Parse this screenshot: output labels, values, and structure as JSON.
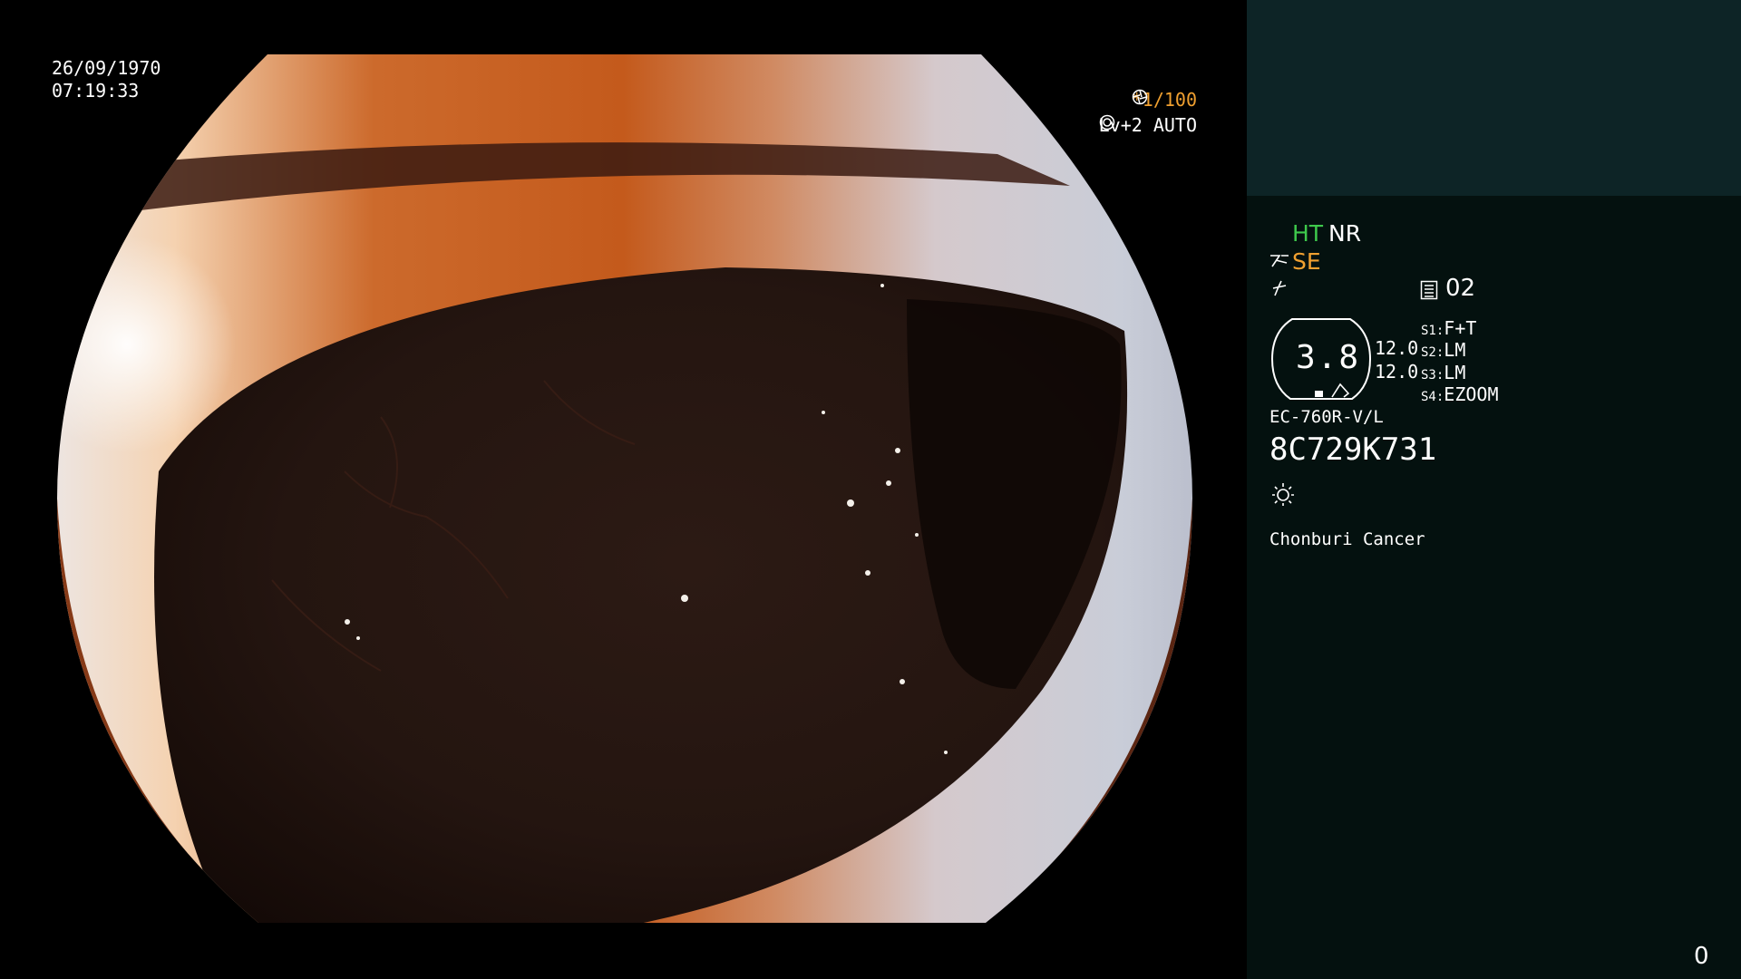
{
  "overlay": {
    "date": "26/09/1970",
    "time": "07:19:33",
    "shutter": "*1/100",
    "shutter_icon": "aperture-icon",
    "level": "Lv+2 AUTO",
    "level_icon": "iris-auto-icon"
  },
  "panel": {
    "ht": "HT",
    "nr": "NR",
    "se": "SE",
    "se_icon": "structure-enhance-icon",
    "color_icon": "color-mode-icon",
    "memo_icon": "memory-card-icon",
    "memo_value": "02",
    "zoom_value": "3.8",
    "lens_values": [
      "12.0",
      "12.0"
    ],
    "switches": [
      {
        "key": "S1:",
        "value": "F+T"
      },
      {
        "key": "S2:",
        "value": "LM"
      },
      {
        "key": "S3:",
        "value": "LM"
      },
      {
        "key": "S4:",
        "value": "EZOOM"
      }
    ],
    "scope_model": "EC-760R-V/L",
    "serial": "8C729K731",
    "light_icon": "light-source-icon",
    "institution": "Chonburi Cancer",
    "counter": "0"
  },
  "colors": {
    "panel_bg": "#04110f",
    "panel_top_bg": "#0d2426",
    "ht_green": "#3ec94c",
    "accent_orange": "#f0a030"
  }
}
